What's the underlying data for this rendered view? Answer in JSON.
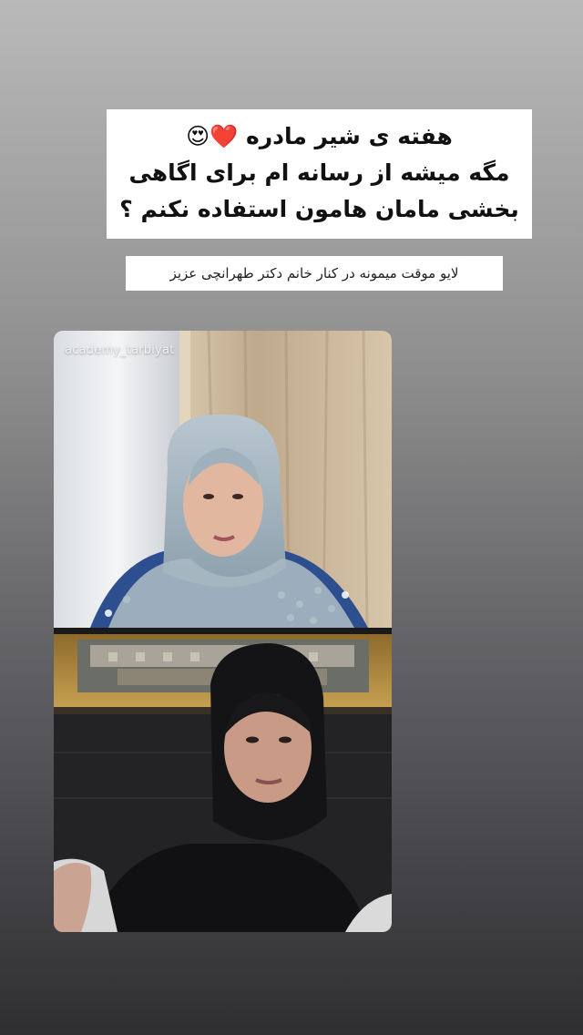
{
  "story": {
    "caption_main": {
      "line1": "هفته ی شیر مادره ❤️😍",
      "line2": "مگه میشه از رسانه ام برای اگاهی",
      "line3": "بخشی مامان هامون استفاده نکنم ؟"
    },
    "caption_sub": "لایو موقت میمونه در کنار خانم دکتر طهرانچی عزیز",
    "live": {
      "watermark": "academy_tarbiyat"
    }
  }
}
